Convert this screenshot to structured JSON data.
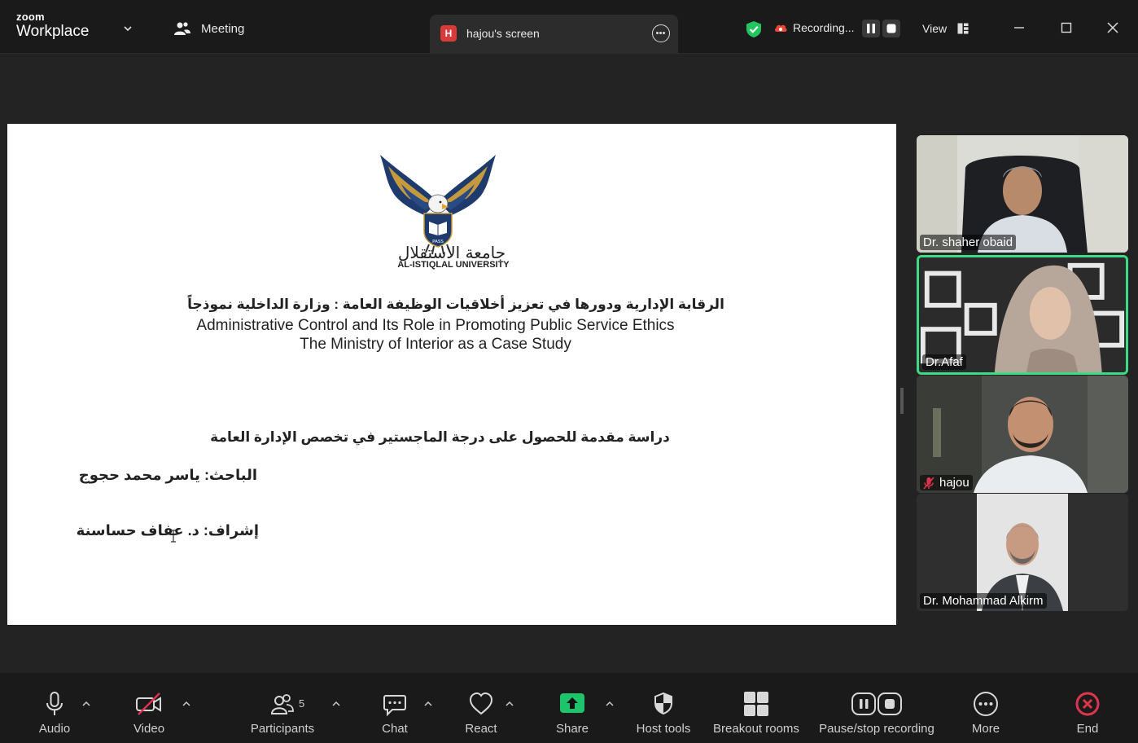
{
  "app": {
    "brand_small": "zoom",
    "brand_large": "Workplace"
  },
  "titlebar": {
    "meeting_label": "Meeting",
    "screen_tab": {
      "badge": "H",
      "label": "hajou's screen"
    },
    "recording_label": "Recording...",
    "view_label": "View"
  },
  "slide": {
    "university_ar": "جامعة الاستقلال",
    "university_en": "AL-ISTIQLAL UNIVERSITY",
    "logo_text": "PASS",
    "title_ar": "الرقابة الإدارية ودورها في تعزيز أخلاقيات الوظيفة العامة : وزارة الداخلية نموذجاً",
    "title_en_1": "Administrative Control and Its Role in Promoting Public Service Ethics",
    "title_en_2": "The Ministry of Interior as a Case Study",
    "study_line": "دراسة مقدمة للحصول على درجة الماجستير في تخصص الإدارة العامة",
    "researcher": "الباحث: ياسر محمد حجوج",
    "supervisor": "إشراف: د. عفاف حساسنة"
  },
  "participants_panel": [
    {
      "name": "Dr. shaher obaid",
      "active": false,
      "muted": false
    },
    {
      "name": "Dr.Afaf",
      "active": true,
      "muted": false
    },
    {
      "name": "hajou",
      "active": false,
      "muted": true
    },
    {
      "name": "Dr. Mohammad Alkirm",
      "active": false,
      "muted": false
    }
  ],
  "toolbar": {
    "audio": "Audio",
    "video": "Video",
    "participants": "Participants",
    "participants_count": "5",
    "chat": "Chat",
    "react": "React",
    "share": "Share",
    "host_tools": "Host tools",
    "breakout_rooms": "Breakout rooms",
    "pause_stop_recording": "Pause/stop recording",
    "more": "More",
    "end": "End"
  },
  "colors": {
    "active_speaker": "#3ddc84",
    "share_green": "#1ec46b",
    "end_red": "#e0334d",
    "recording_red": "#e8473a"
  }
}
